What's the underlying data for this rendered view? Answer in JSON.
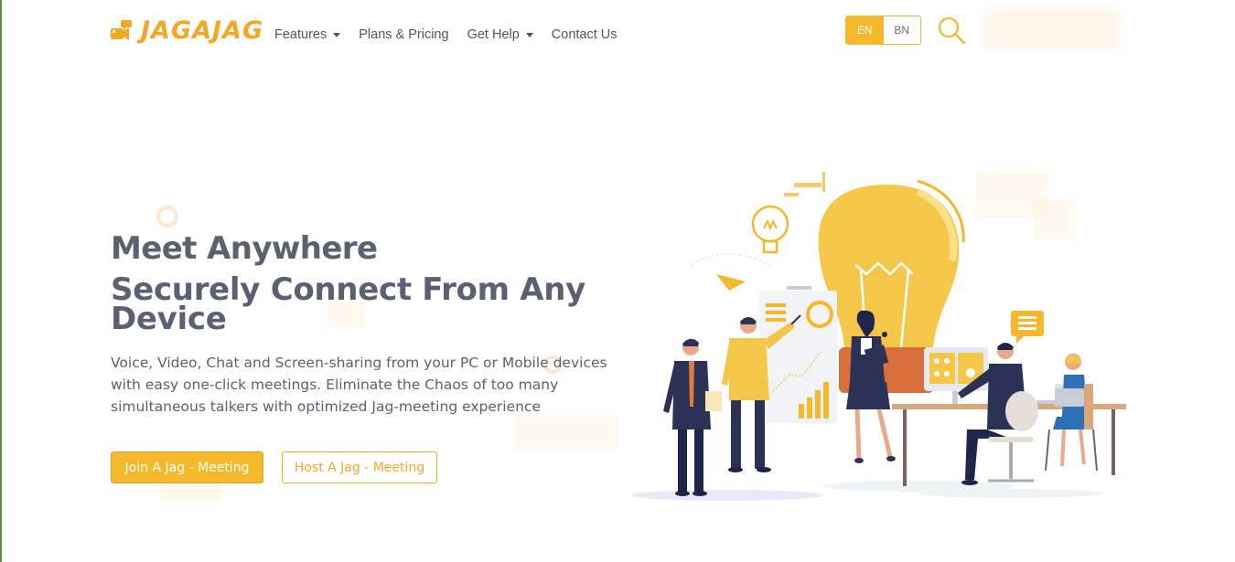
{
  "brand": {
    "name": "JAGAJAG",
    "logo_icon": "camera-chat-icon",
    "color": "#f5a623"
  },
  "nav": {
    "items": [
      {
        "label": "Features",
        "dropdown": true
      },
      {
        "label": "Plans & Pricing",
        "dropdown": false
      },
      {
        "label": "Get Help",
        "dropdown": true
      },
      {
        "label": "Contact Us",
        "dropdown": false
      }
    ]
  },
  "language": {
    "options": [
      "EN",
      "BN"
    ],
    "selected": "EN"
  },
  "search": {
    "icon": "search-icon"
  },
  "hero": {
    "title": "Meet Anywhere",
    "subtitle": "Securely Connect From Any Device",
    "description": "Voice, Video, Chat and Screen-sharing from your PC or Mobile devices with easy one-click meetings. Eliminate the Chaos of too many simultaneous talkers with optimized Jag-meeting experience",
    "primary_button": "Join A Jag - Meeting",
    "secondary_button": "Host A Jag - Meeting"
  },
  "colors": {
    "accent": "#f5b82a",
    "text": "#5b6072",
    "navy": "#2b3256"
  }
}
